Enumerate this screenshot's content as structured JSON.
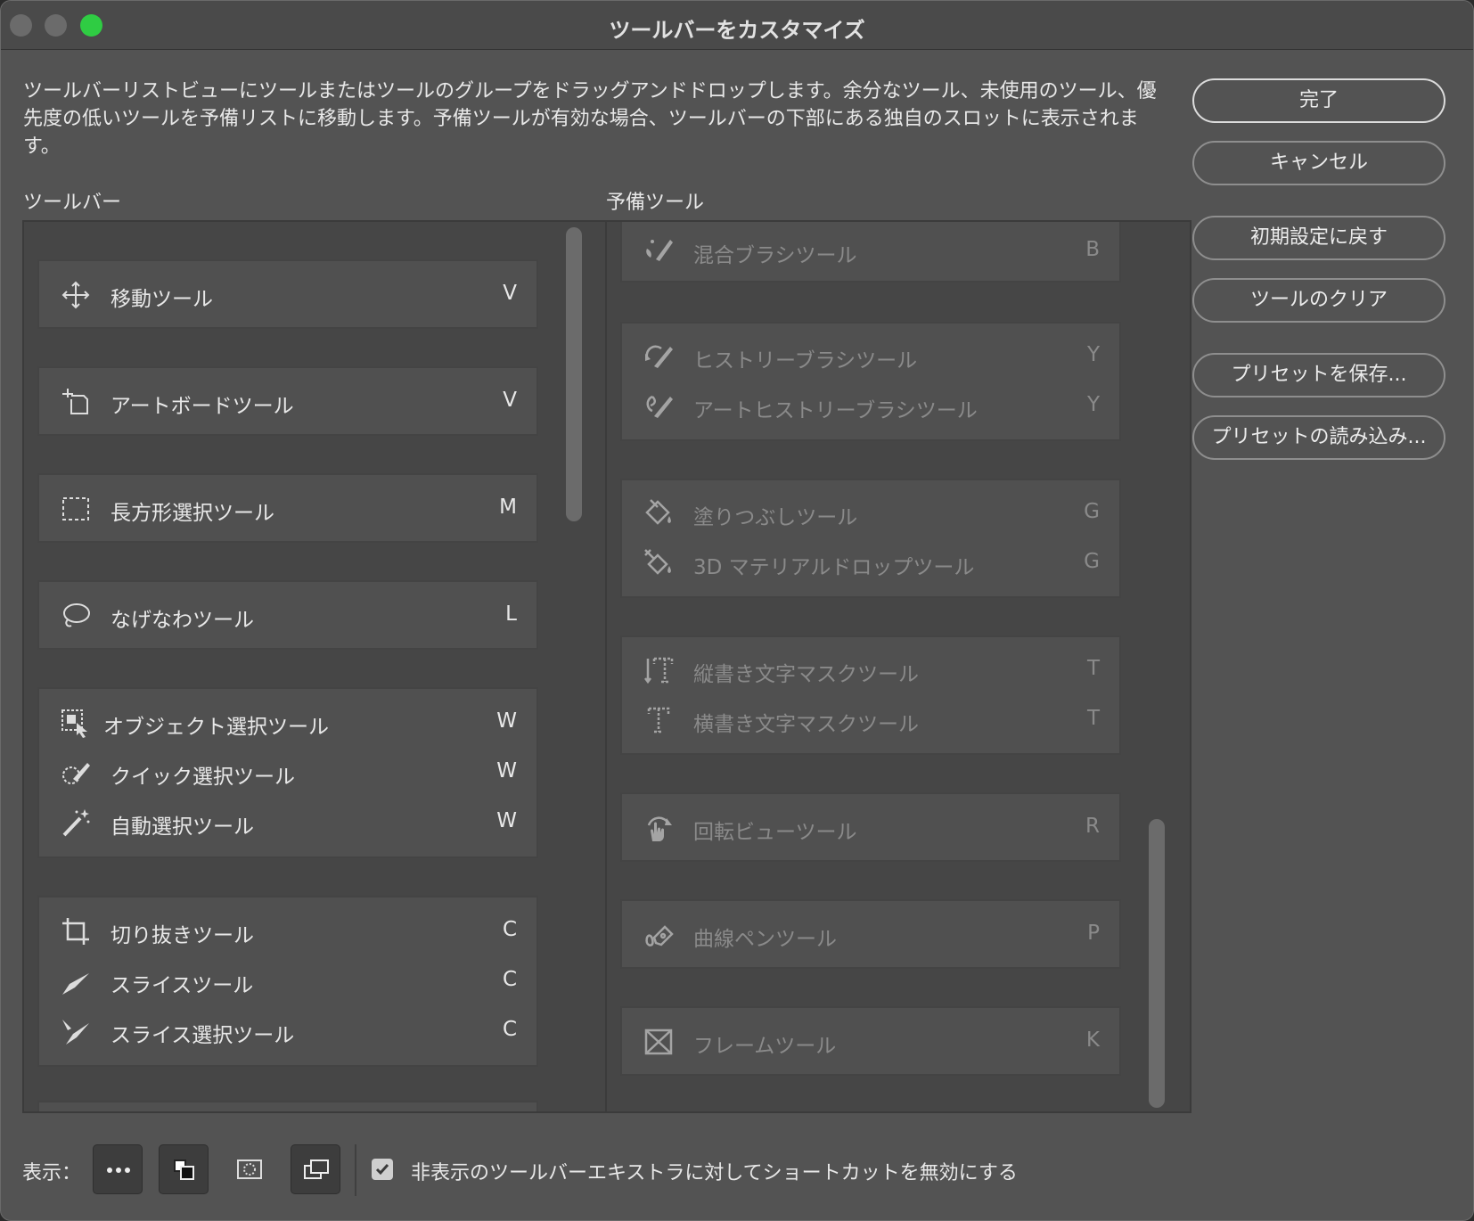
{
  "window": {
    "title": "ツールバーをカスタマイズ"
  },
  "description": "ツールバーリストビューにツールまたはツールのグループをドラッグアンドドロップします。余分なツール、未使用のツール、優先度の低いツールを予備リストに移動します。予備ツールが有効な場合、ツールバーの下部にある独自のスロットに表示されます。",
  "toolbar": {
    "label": "ツールバー",
    "groups": [
      [
        {
          "label": "移動ツール",
          "key": "V",
          "icon": "move-icon"
        }
      ],
      [
        {
          "label": "アートボードツール",
          "key": "V",
          "icon": "artboard-icon"
        }
      ],
      [
        {
          "label": "長方形選択ツール",
          "key": "M",
          "icon": "rectangular-marquee-icon"
        }
      ],
      [
        {
          "label": "なげなわツール",
          "key": "L",
          "icon": "lasso-icon"
        }
      ],
      [
        {
          "label": "オブジェクト選択ツール",
          "key": "W",
          "icon": "object-selection-icon"
        },
        {
          "label": "クイック選択ツール",
          "key": "W",
          "icon": "quick-selection-icon"
        },
        {
          "label": "自動選択ツール",
          "key": "W",
          "icon": "magic-wand-icon"
        }
      ],
      [
        {
          "label": "切り抜きツール",
          "key": "C",
          "icon": "crop-icon"
        },
        {
          "label": "スライスツール",
          "key": "C",
          "icon": "slice-icon"
        },
        {
          "label": "スライス選択ツール",
          "key": "C",
          "icon": "slice-select-icon"
        }
      ]
    ]
  },
  "extra": {
    "label": "予備ツール",
    "groups": [
      [
        {
          "label": "混合ブラシツール",
          "key": "B",
          "icon": "mixer-brush-icon"
        }
      ],
      [
        {
          "label": "ヒストリーブラシツール",
          "key": "Y",
          "icon": "history-brush-icon"
        },
        {
          "label": "アートヒストリーブラシツール",
          "key": "Y",
          "icon": "art-history-brush-icon"
        }
      ],
      [
        {
          "label": "塗りつぶしツール",
          "key": "G",
          "icon": "paint-bucket-icon"
        },
        {
          "label": "3D マテリアルドロップツール",
          "key": "G",
          "icon": "3d-material-drop-icon"
        }
      ],
      [
        {
          "label": "縦書き文字マスクツール",
          "key": "T",
          "icon": "vertical-type-mask-icon"
        },
        {
          "label": "横書き文字マスクツール",
          "key": "T",
          "icon": "horizontal-type-mask-icon"
        }
      ],
      [
        {
          "label": "回転ビューツール",
          "key": "R",
          "icon": "rotate-view-icon"
        }
      ],
      [
        {
          "label": "曲線ペンツール",
          "key": "P",
          "icon": "curvature-pen-icon"
        }
      ],
      [
        {
          "label": "フレームツール",
          "key": "K",
          "icon": "frame-icon"
        }
      ]
    ]
  },
  "buttons": {
    "done": "完了",
    "cancel": "キャンセル",
    "restore_defaults": "初期設定に戻す",
    "clear_tools": "ツールのクリア",
    "save_preset": "プリセットを保存...",
    "load_preset": "プリセットの読み込み..."
  },
  "bottom": {
    "show_label": "表示：",
    "view_buttons": [
      "more-icon",
      "swatches-icon",
      "quick-mask-icon",
      "screen-mode-icon"
    ],
    "checkbox_checked": true,
    "checkbox_label": "非表示のツールバーエキストラに対してショートカットを無効にする"
  }
}
